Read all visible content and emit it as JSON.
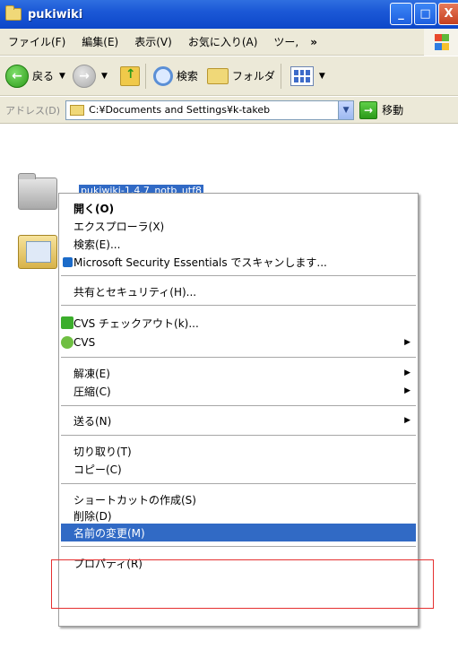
{
  "window": {
    "title": "pukiwiki",
    "controls": {
      "minimize": "_",
      "maximize": "□",
      "close": "X"
    }
  },
  "menubar": {
    "items": [
      "ファイル(F)",
      "編集(E)",
      "表示(V)",
      "お気に入り(A)",
      "ツー,"
    ],
    "overflow": "»"
  },
  "toolbar": {
    "back_label": "戻る",
    "search_label": "検索",
    "folders_label": "フォルダ"
  },
  "addressbar": {
    "label": "アドレス(D)",
    "path": "C:¥Documents and Settings¥k-takeb",
    "go_label": "移動"
  },
  "content": {
    "selected_file": "pukiwiki-1.4.7_notb_utf8"
  },
  "context_menu": {
    "items": [
      {
        "label": "開く(O)",
        "bold": true
      },
      {
        "label": "エクスプローラ(X)"
      },
      {
        "label": "検索(E)..."
      },
      {
        "label": "Microsoft Security Essentials でスキャンします..."
      },
      {
        "label": "共有とセキュリティ(H)..."
      },
      {
        "label": "CVS チェックアウト(k)..."
      },
      {
        "label": "CVS"
      },
      {
        "label": "解凍(E)"
      },
      {
        "label": "圧縮(C)"
      },
      {
        "label": "送る(N)"
      },
      {
        "label": "切り取り(T)"
      },
      {
        "label": "コピー(C)"
      },
      {
        "label": "ショートカットの作成(S)"
      },
      {
        "label": "削除(D)"
      },
      {
        "label": "名前の変更(M)",
        "highlighted": true
      },
      {
        "label": "プロパティ(R)"
      }
    ],
    "submenu_arrow": "▶"
  },
  "colors": {
    "titlebar": "#1b58d6",
    "highlight": "#316ac5",
    "annotation_box": "#e53030"
  }
}
